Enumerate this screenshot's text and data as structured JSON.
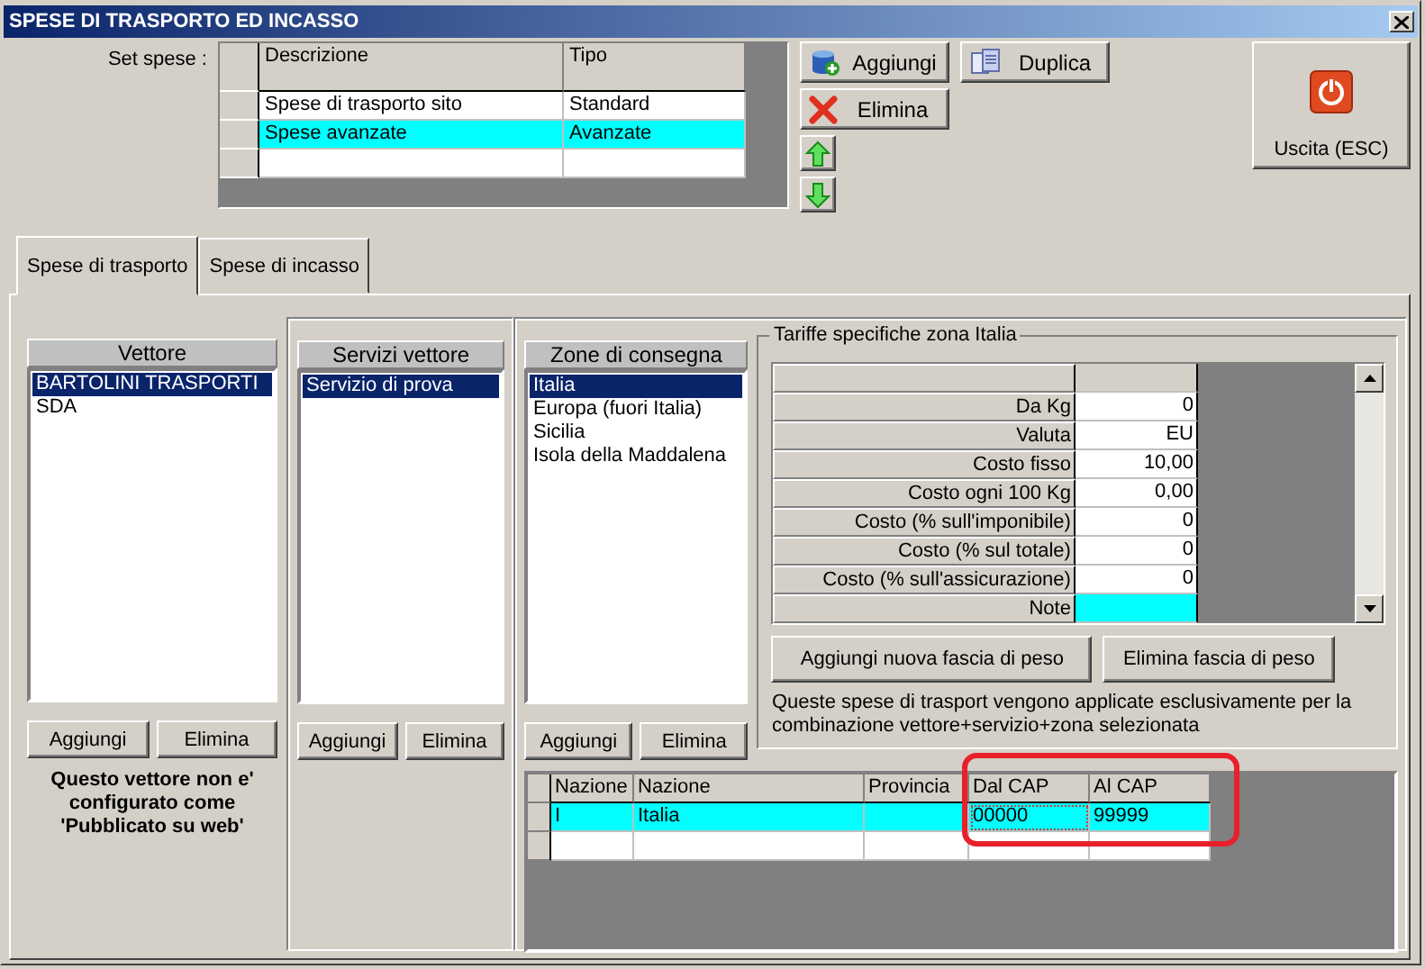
{
  "window": {
    "title": "SPESE DI TRASPORTO ED INCASSO"
  },
  "set_spese": {
    "label": "Set spese :",
    "columns": [
      "Descrizione",
      "Tipo"
    ],
    "rows": [
      {
        "descrizione": "Spese di trasporto sito",
        "tipo": "Standard",
        "selected": false
      },
      {
        "descrizione": "Spese avanzate",
        "tipo": "Avanzate",
        "selected": true
      }
    ]
  },
  "toolbar": [
    {
      "label": "Aggiungi",
      "kind": "add"
    },
    {
      "label": "Duplica",
      "kind": "duplicate"
    },
    {
      "label": "Elimina",
      "kind": "delete"
    }
  ],
  "exit_button": {
    "label": "Uscita (ESC)"
  },
  "tabs": [
    {
      "label": "Spese di trasporto",
      "selected": true
    },
    {
      "label": "Spese di incasso",
      "selected": false
    }
  ],
  "lists": [
    {
      "header": "Vettore",
      "items": [
        {
          "label": "BARTOLINI TRASPORTI",
          "selected": true
        },
        {
          "label": "SDA",
          "selected": false
        }
      ],
      "buttons": [
        "Aggiungi",
        "Elimina"
      ]
    },
    {
      "header": "Servizi vettore",
      "items": [
        {
          "label": "Servizio di prova",
          "selected": true
        }
      ],
      "buttons": [
        "Aggiungi",
        "Elimina"
      ]
    },
    {
      "header": "Zone di consegna",
      "items": [
        {
          "label": "Italia",
          "selected": true
        },
        {
          "label": "Europa (fuori Italia)",
          "selected": false
        },
        {
          "label": "Sicilia",
          "selected": false
        },
        {
          "label": "Isola della Maddalena",
          "selected": false
        }
      ],
      "buttons": [
        "Aggiungi",
        "Elimina"
      ]
    }
  ],
  "vettore_note": "Questo vettore non e' configurato come 'Pubblicato su web'",
  "tariffe": {
    "title": "Tariffe specifiche zona Italia",
    "rows": [
      {
        "label": "Da Kg",
        "value": "0",
        "selected": false
      },
      {
        "label": "Valuta",
        "value": "EU",
        "selected": false
      },
      {
        "label": "Costo fisso",
        "value": "10,00",
        "selected": false
      },
      {
        "label": "Costo ogni 100 Kg",
        "value": "0,00",
        "selected": false
      },
      {
        "label": "Costo (% sull'imponibile)",
        "value": "0",
        "selected": false
      },
      {
        "label": "Costo (% sul totale)",
        "value": "0",
        "selected": false
      },
      {
        "label": "Costo (% sull'assicurazione)",
        "value": "0",
        "selected": false
      },
      {
        "label": "Note",
        "selected": true
      }
    ],
    "buttons": [
      "Aggiungi nuova fascia di peso",
      "Elimina fascia di peso"
    ],
    "info": "Queste spese di trasport vengono applicate esclusivamente per la combinazione vettore+servizio+zona selezionata"
  },
  "cap_table": {
    "columns": [
      "Nazione",
      "Nazione",
      "Provincia",
      "Dal CAP",
      "Al CAP"
    ],
    "rows": [
      {
        "nazione_code": "I",
        "nazione": "Italia",
        "dal_cap": "00000",
        "al_cap": "99999",
        "selected": true
      }
    ]
  }
}
